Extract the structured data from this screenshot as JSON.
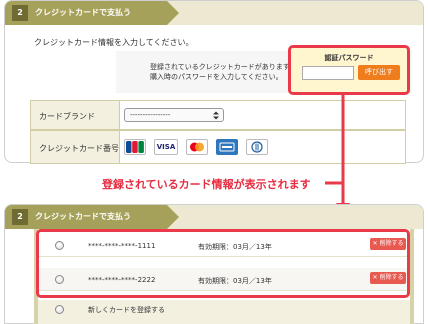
{
  "top_panel": {
    "step_number": "2",
    "step_title": "クレジットカードで支払う",
    "instruction": "クレジットカード情報を入力してください。",
    "notice_line1": "登録されているクレジットカードがあります。",
    "notice_line2": "購入時のパスワードを入力してください。",
    "auth": {
      "title": "認証パスワード",
      "password_value": "",
      "button_label": "呼び出す"
    },
    "form": {
      "brand_label": "カードブランド",
      "brand_selected": "----------------",
      "number_label": "クレジットカード番号",
      "card_logos": [
        {
          "name": "JCB",
          "icon": "jcb-logo"
        },
        {
          "name": "VISA",
          "icon": "visa-logo"
        },
        {
          "name": "MasterCard",
          "icon": "mastercard-logo"
        },
        {
          "name": "AMERICAN EXPRESS",
          "icon": "amex-logo"
        },
        {
          "name": "Diners Club",
          "icon": "diners-logo"
        }
      ]
    }
  },
  "callout": "登録されているカード情報が表示されます",
  "bottom_panel": {
    "step_number": "2",
    "step_title": "クレジットカードで支払う",
    "saved_cards": [
      {
        "number": "****-****-****-1111",
        "expiry": "有効期限：03月／13年",
        "delete_label": "✕ 削除する"
      },
      {
        "number": "****-****-****-2222",
        "expiry": "有効期限：03月／13年",
        "delete_label": "✕ 削除する"
      }
    ],
    "new_card_label": "新しくカードを登録する"
  },
  "colors": {
    "accent_red": "#ea3a49",
    "header_olive": "#a6a15a",
    "button_orange": "#f07d1c",
    "delete_red": "#e85a50"
  }
}
